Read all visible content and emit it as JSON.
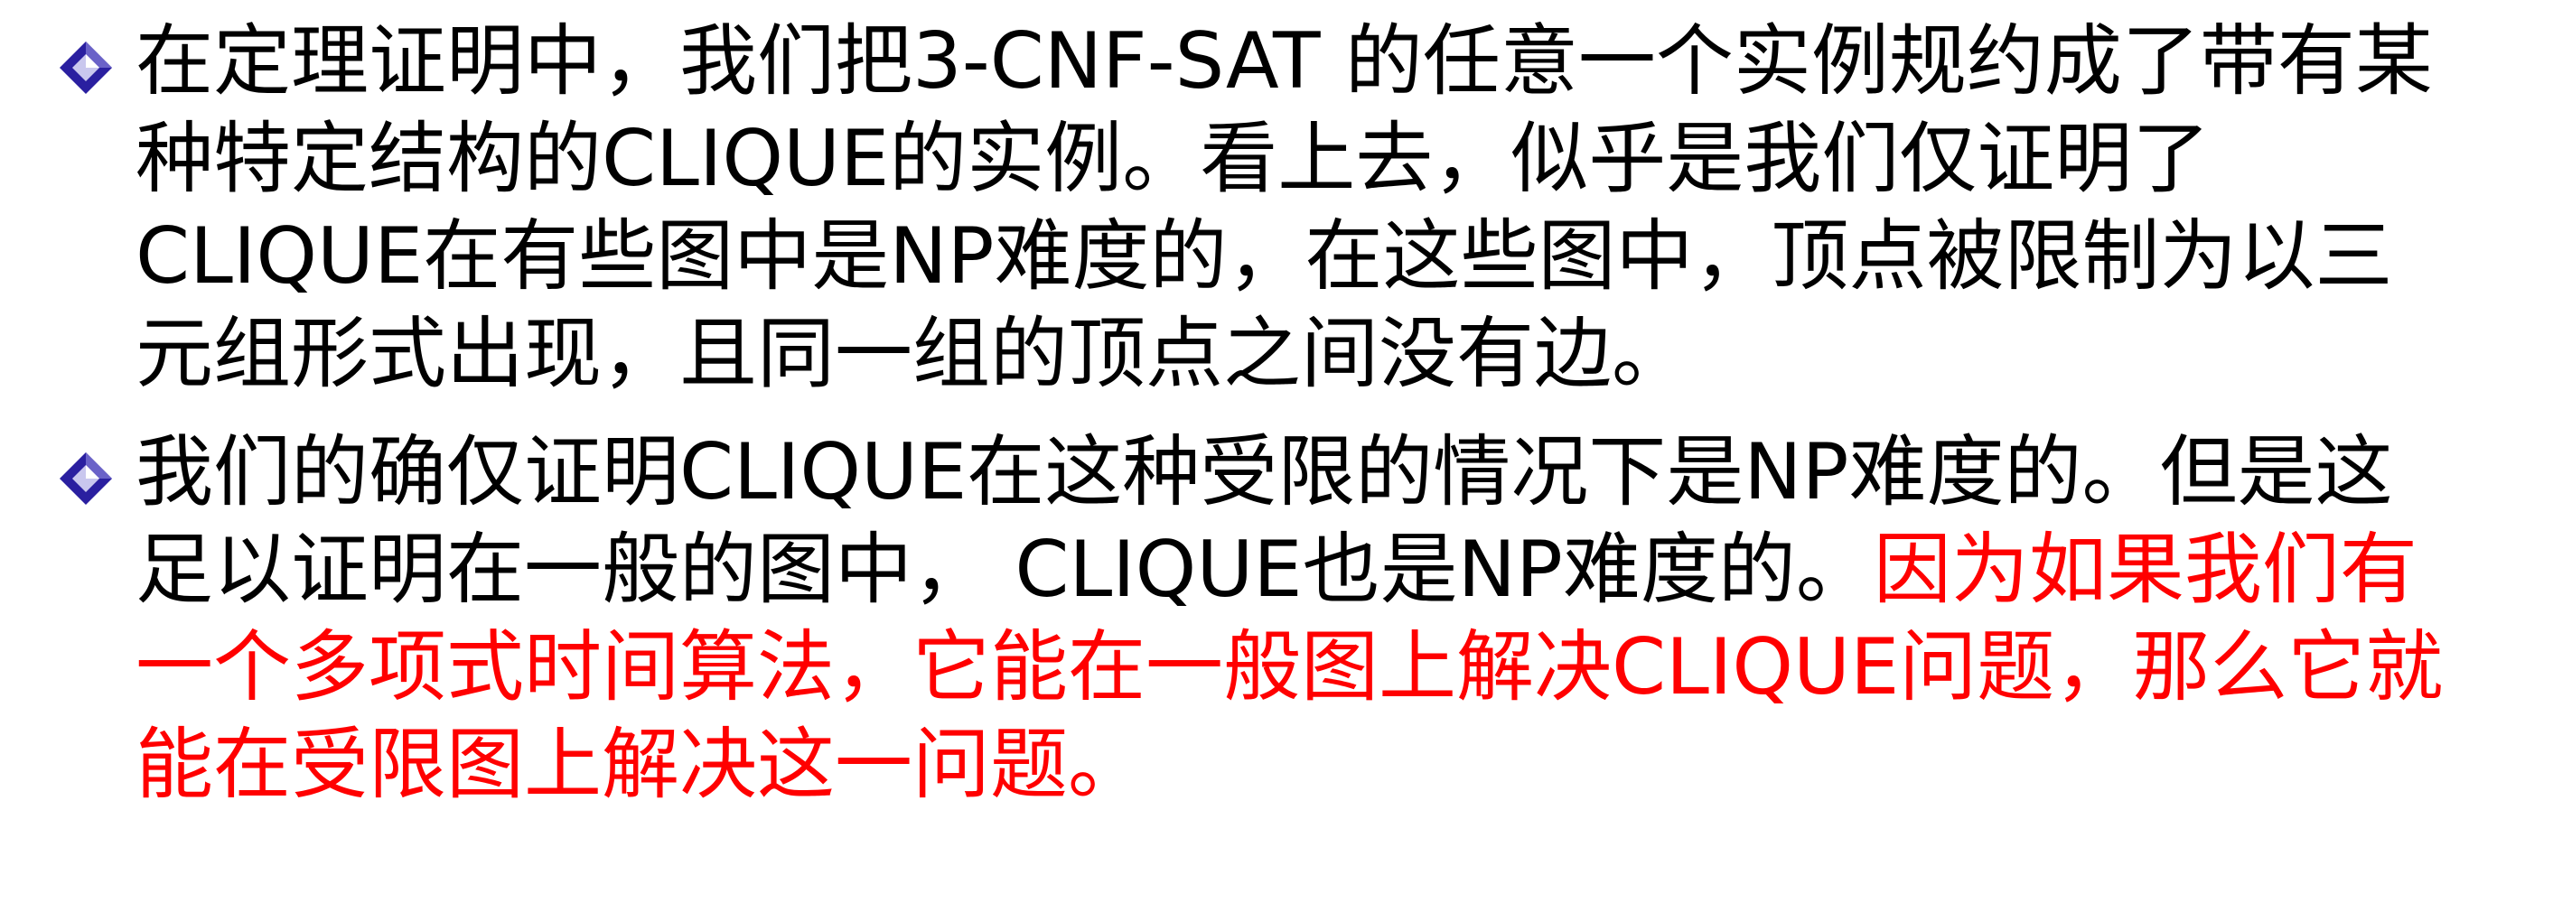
{
  "colors": {
    "text": "#000000",
    "highlight": "#ff0000",
    "bullet_fill": "#2a1fa0",
    "bullet_light": "#c9c7ee"
  },
  "bullets": [
    {
      "icon": "diamond-bullet-icon",
      "lines": [
        {
          "segments": [
            {
              "text": "在定理证明中，我们把3-CNF-SAT 的任意一个实例规约成了带有某",
              "color": "black"
            }
          ]
        },
        {
          "segments": [
            {
              "text": "种特定结构的CLIQUE的实例。看上去，似乎是我们仅证明了",
              "color": "black"
            }
          ]
        },
        {
          "segments": [
            {
              "text": "CLIQUE在有些图中是NP难度的，在这些图中，顶点被限制为以三",
              "color": "black"
            }
          ]
        },
        {
          "segments": [
            {
              "text": "元组形式出现，且同一组的顶点之间没有边。",
              "color": "black"
            }
          ]
        }
      ]
    },
    {
      "icon": "diamond-bullet-icon",
      "lines": [
        {
          "segments": [
            {
              "text": "我们的确仅证明CLIQUE在这种受限的情况下是NP难度的。但是这",
              "color": "black"
            }
          ]
        },
        {
          "segments": [
            {
              "text": "足以证明在一般的图中， CLIQUE也是NP难度的。",
              "color": "black"
            },
            {
              "text": "因为如果我们有",
              "color": "red"
            }
          ]
        },
        {
          "segments": [
            {
              "text": "一个多项式时间算法，它能在一般图上解决CLIQUE问题，那么它就",
              "color": "red"
            }
          ]
        },
        {
          "segments": [
            {
              "text": "能在受限图上解决这一问题。",
              "color": "red"
            }
          ]
        }
      ]
    }
  ]
}
